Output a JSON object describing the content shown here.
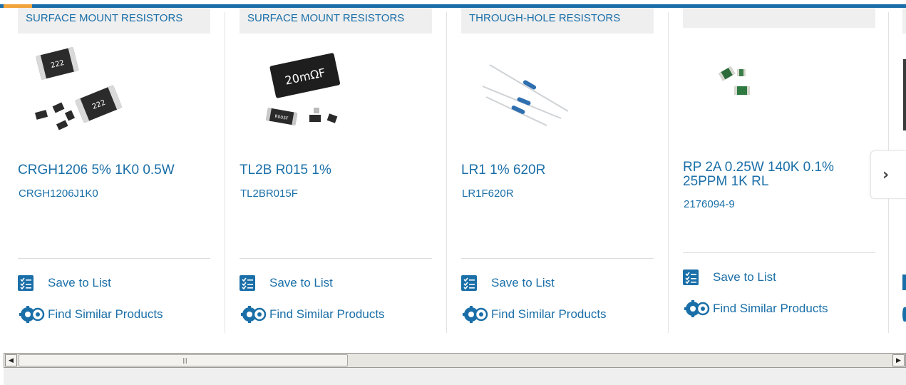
{
  "colors": {
    "accent": "#1a6fa8",
    "top_bar": "#1b6ea8",
    "top_bar_highlight": "#f2a33a",
    "tag_bg": "#efefef"
  },
  "products": [
    {
      "category": "SURFACE MOUNT RESISTORS",
      "title": "CRGH1206 5% 1K0 0.5W",
      "code": "CRGH1206J1K0",
      "save_label": "Save to List",
      "similar_label": "Find Similar Products"
    },
    {
      "category": "SURFACE MOUNT RESISTORS",
      "title": "TL2B R015 1%",
      "code": "TL2BR015F",
      "save_label": "Save to List",
      "similar_label": "Find Similar Products"
    },
    {
      "category": "THROUGH-HOLE RESISTORS",
      "title": "LR1 1% 620R",
      "code": "LR1F620R",
      "save_label": "Save to List",
      "similar_label": "Find Similar Products"
    },
    {
      "category": "",
      "title": "RP 2A 0.25W 140K 0.1% 25PPM 1K RL",
      "code": "2176094-9",
      "save_label": "Save to List",
      "similar_label": "Find Similar Products"
    }
  ],
  "images": {
    "p0_text_a": "222",
    "p0_text_b": "222",
    "p1_text_a": "20mΩF",
    "p1_text_b": "R005F"
  },
  "carousel": {
    "next_icon": "chevron-right-icon",
    "next_glyph": "›"
  },
  "scrollbar": {
    "left_arrow": "◀",
    "right_arrow": "▶"
  }
}
